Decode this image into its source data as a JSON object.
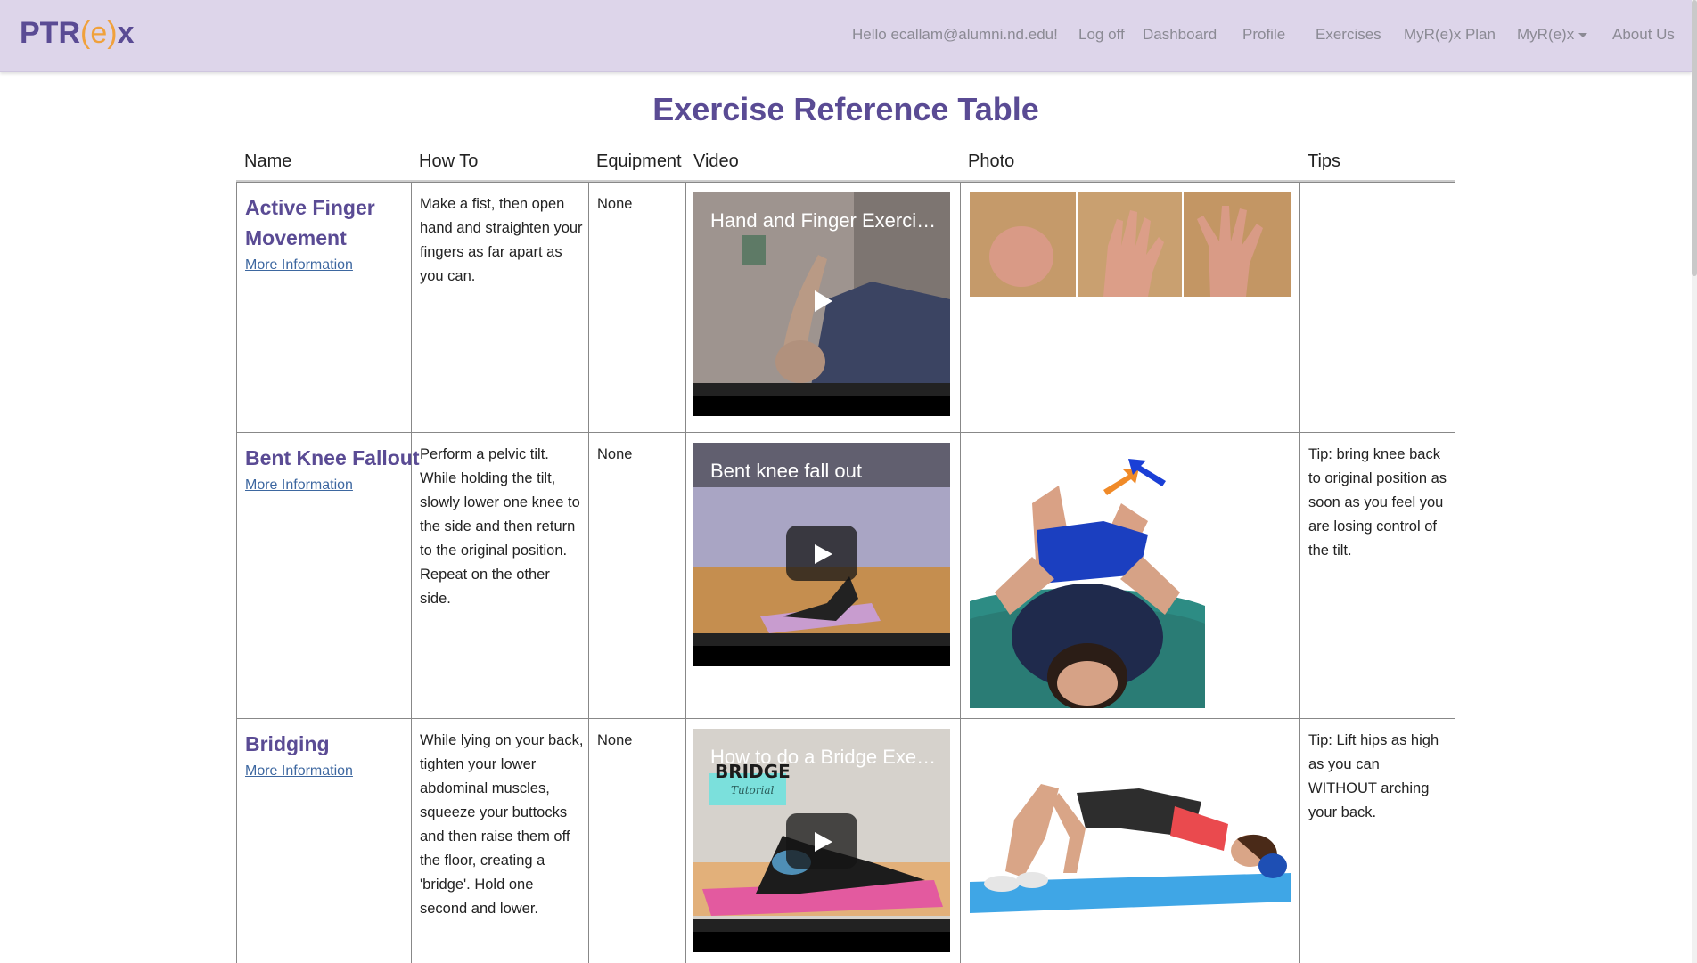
{
  "brand": {
    "prefix": "PTR",
    "paren_open": "(",
    "e": "e",
    "paren_close": ")",
    "suffix": "x"
  },
  "nav": {
    "greeting": "Hello ecallam@alumni.nd.edu!",
    "logoff": "Log off",
    "dashboard": "Dashboard",
    "profile": "Profile",
    "exercises": "Exercises",
    "plan": "MyR(e)x Plan",
    "myrex": "MyR(e)x",
    "about": "About Us"
  },
  "page_title": "Exercise Reference Table",
  "columns": {
    "name": "Name",
    "howto": "How To",
    "equipment": "Equipment",
    "video": "Video",
    "photo": "Photo",
    "tips": "Tips"
  },
  "rows": [
    {
      "name": "Active Finger Movement",
      "more": "More Information",
      "howto": "Make a fist, then open hand and straighten your fingers as far apart as you can.",
      "equipment": "None",
      "video_title": "Hand and Finger Exercis...",
      "tips": ""
    },
    {
      "name": "Bent Knee Fallout",
      "more": "More Information",
      "howto": "Perform a pelvic tilt. While holding the tilt, slowly lower one knee to the side and then return to the original position. Repeat on the other side.",
      "equipment": "None",
      "video_title": "Bent knee fall out",
      "tips": "Tip: bring knee back to original position as soon as you feel you are losing control of the tilt."
    },
    {
      "name": "Bridging",
      "more": "More Information",
      "howto": "While lying on your back, tighten your lower abdominal muscles, squeeze your buttocks and then raise them off the floor, creating a 'bridge'. Hold one second and lower.",
      "equipment": "None",
      "video_title": "How to do a Bridge Exer...",
      "video_overlay": "BRIDGE",
      "video_overlay_sub": "Tutorial",
      "tips": "Tip: Lift hips as high as you can WITHOUT arching your back."
    }
  ],
  "colors": {
    "nav_bg": "#ddd5ea",
    "brand": "#5a4b94",
    "brand_accent": "#f0a13c",
    "link": "#3d67a0"
  }
}
